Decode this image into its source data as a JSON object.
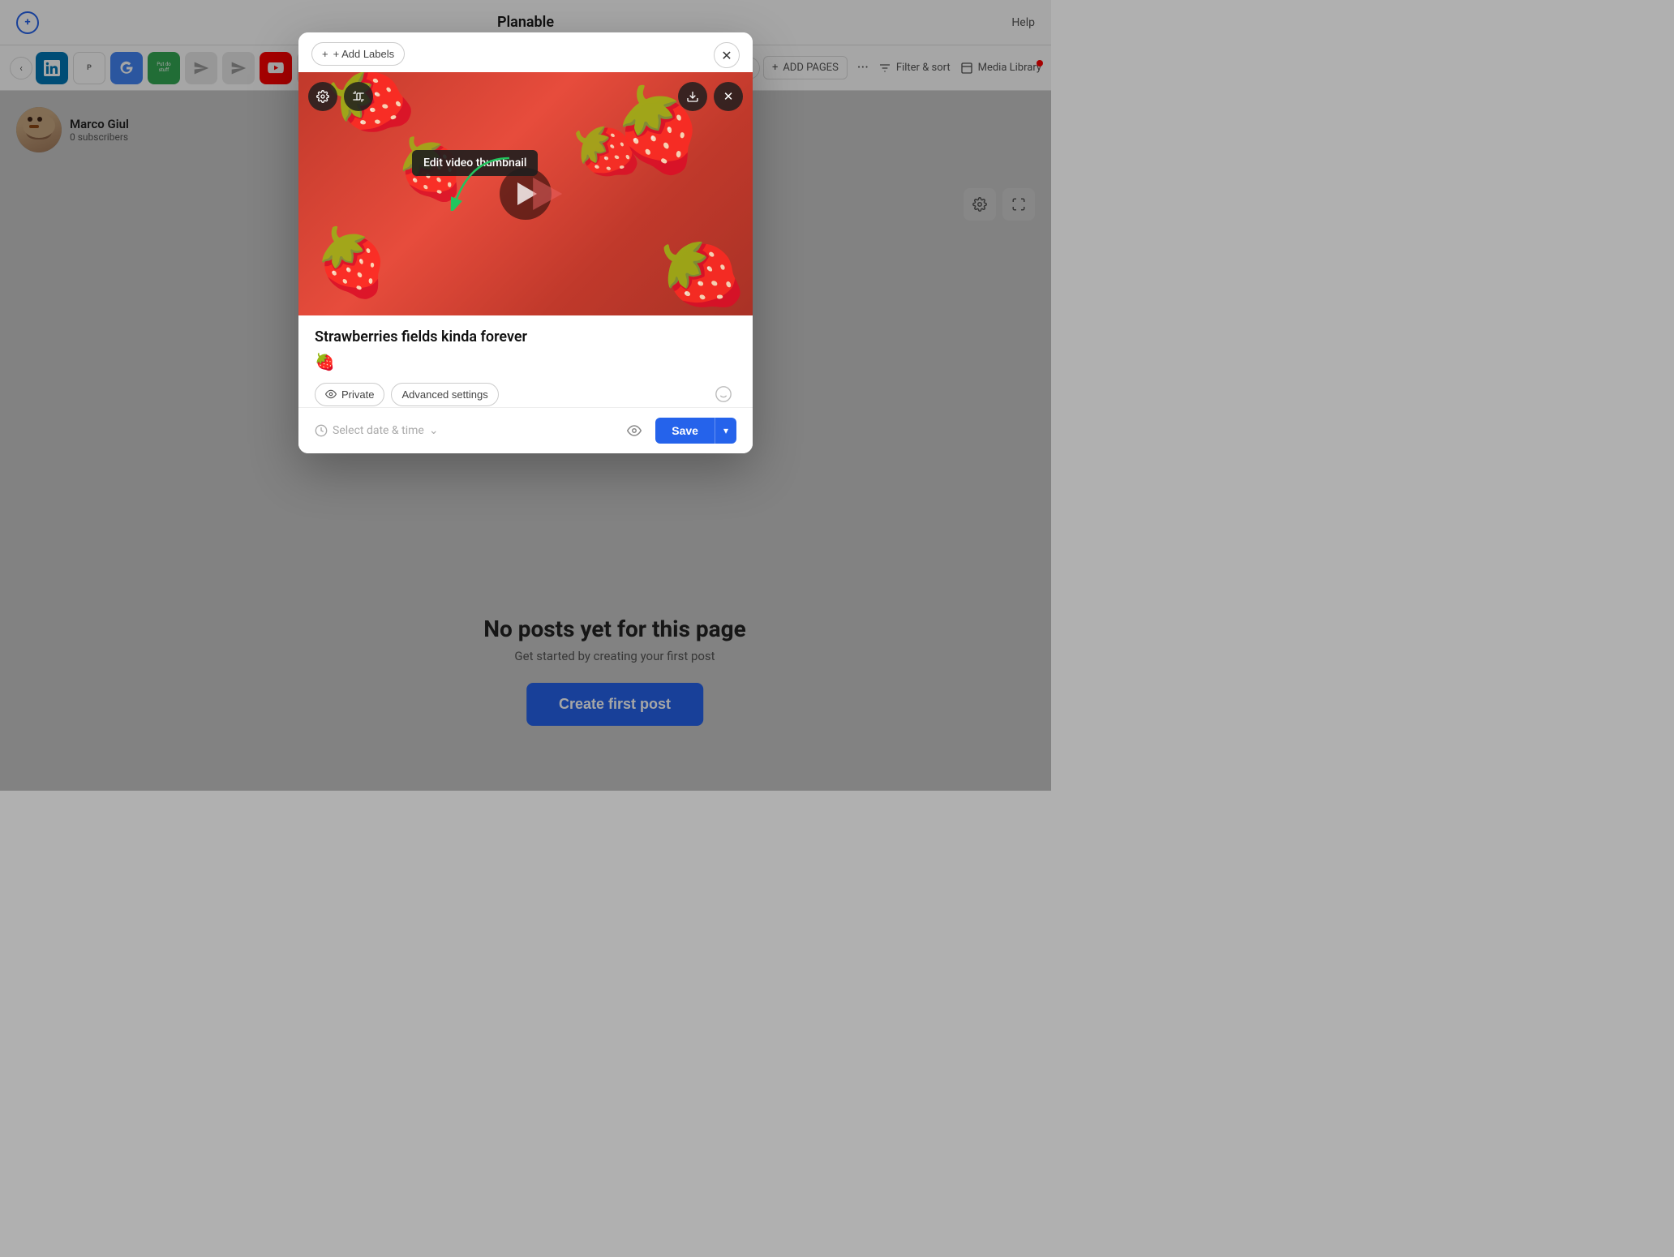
{
  "app": {
    "title": "Planable",
    "help_label": "Help"
  },
  "toolbar": {
    "add_pages_label": "ADD PAGES",
    "filter_sort_label": "Filter & sort",
    "media_library_label": "Media Library",
    "add_labels_label": "+ Add Labels"
  },
  "profile": {
    "name": "Marco Giul",
    "subscribers": "0 subscribers"
  },
  "no_posts": {
    "title": "No posts yet for this page",
    "subtitle": "Get started by creating your first post",
    "create_btn": "Create first post"
  },
  "modal": {
    "add_labels": "+ Add Labels",
    "post_title": "Strawberries fields kinda forever",
    "post_emoji": "🍓",
    "private_label": "Private",
    "advanced_label": "Advanced settings",
    "date_placeholder": "Select date & time",
    "save_label": "Save",
    "tooltip": "Edit video thumbnail",
    "icons": {
      "gear": "⚙",
      "scissors": "✂",
      "download": "⬇",
      "close": "✕",
      "play": "▶",
      "eye": "👁",
      "smiley": "☺",
      "clock": "🕐",
      "chevron_down": "⌄",
      "plus": "+",
      "eye_private": "👁"
    }
  },
  "pages": [
    {
      "id": "linkedin",
      "type": "linkedin"
    },
    {
      "id": "google1",
      "type": "google"
    },
    {
      "id": "google2",
      "type": "google"
    },
    {
      "id": "youtube",
      "type": "youtube"
    },
    {
      "id": "instagram",
      "type": "instagram"
    },
    {
      "id": "facebook",
      "type": "facebook"
    },
    {
      "id": "twitter",
      "type": "twitter"
    },
    {
      "id": "linkedin2",
      "type": "linkedin"
    }
  ]
}
